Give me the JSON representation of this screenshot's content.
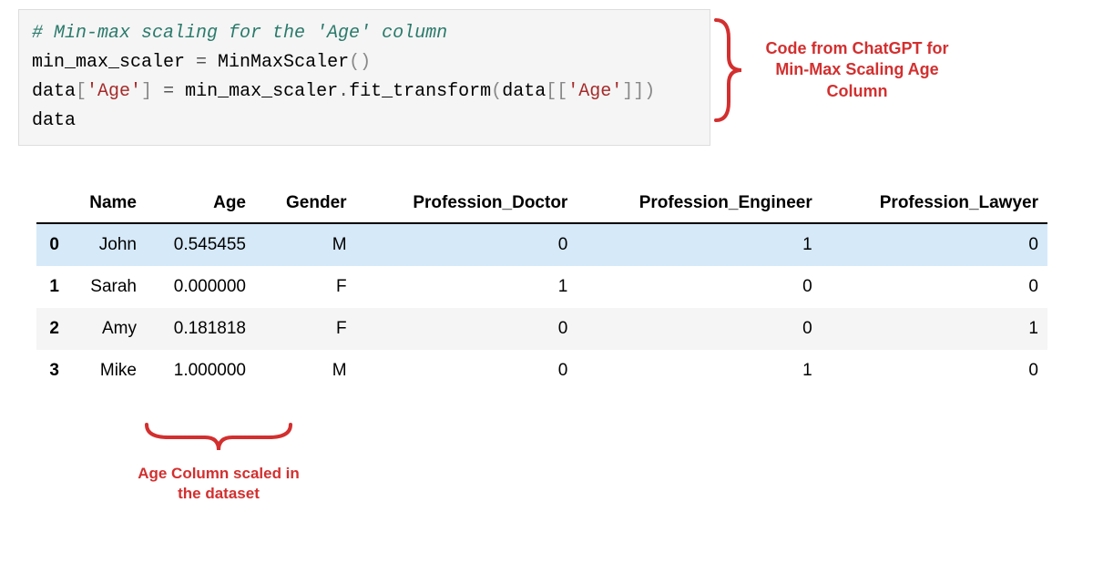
{
  "code": {
    "comment": "# Min-max scaling for the 'Age' column",
    "line2a": "min_max_scaler ",
    "line2b": "=",
    "line2c": " MinMaxScaler",
    "line2d": "()",
    "line3a": "data",
    "line3b": "[",
    "line3c": "'Age'",
    "line3d": "]",
    "line3e": " ",
    "line3f": "=",
    "line3g": " min_max_scaler",
    "line3h": ".",
    "line3i": "fit_transform",
    "line3j": "(",
    "line3k": "data",
    "line3l": "[[",
    "line3m": "'Age'",
    "line3n": "]])",
    "line4": "data"
  },
  "annotations": {
    "right": "Code from ChatGPT for Min-Max Scaling Age Column",
    "bottom": "Age Column scaled in the dataset"
  },
  "table": {
    "headers": {
      "blank": "",
      "name": "Name",
      "age": "Age",
      "gender": "Gender",
      "doctor": "Profession_Doctor",
      "engineer": "Profession_Engineer",
      "lawyer": "Profession_Lawyer"
    },
    "rows": [
      {
        "idx": "0",
        "name": "John",
        "age": "0.545455",
        "gender": "M",
        "doctor": "0",
        "engineer": "1",
        "lawyer": "0"
      },
      {
        "idx": "1",
        "name": "Sarah",
        "age": "0.000000",
        "gender": "F",
        "doctor": "1",
        "engineer": "0",
        "lawyer": "0"
      },
      {
        "idx": "2",
        "name": "Amy",
        "age": "0.181818",
        "gender": "F",
        "doctor": "0",
        "engineer": "0",
        "lawyer": "1"
      },
      {
        "idx": "3",
        "name": "Mike",
        "age": "1.000000",
        "gender": "M",
        "doctor": "0",
        "engineer": "1",
        "lawyer": "0"
      }
    ]
  }
}
